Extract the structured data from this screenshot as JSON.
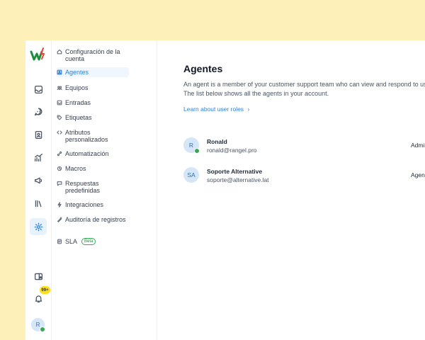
{
  "main": {
    "title": "Agentes",
    "description_line1": "An agent is a member of your customer support team who can view and respond to user messages.",
    "description_line2": "The list below shows all the agents in your account.",
    "learn_link": "Learn about user roles",
    "agents": [
      {
        "initials": "R",
        "name": "Ronald",
        "email": "ronald@rangel.pro",
        "role": "Administrador",
        "online": true
      },
      {
        "initials": "SA",
        "name": "Soporte Alternative",
        "email": "soporte@alternative.lat",
        "role": "Agente",
        "online": false
      }
    ]
  },
  "settings_nav": {
    "items": [
      {
        "label": "Configuración de la cuenta",
        "icon": "home-icon"
      },
      {
        "label": "Agentes",
        "icon": "agents-icon",
        "active": true
      },
      {
        "label": "Equipos",
        "icon": "teams-icon"
      },
      {
        "label": "Entradas",
        "icon": "inboxes-icon"
      },
      {
        "label": "Etiquetas",
        "icon": "tag-icon"
      },
      {
        "label": "Atributos personalizados",
        "icon": "code-icon"
      },
      {
        "label": "Automatización",
        "icon": "automation-icon"
      },
      {
        "label": "Macros",
        "icon": "macros-icon"
      },
      {
        "label": "Respuestas predefinidas",
        "icon": "canned-responses-icon"
      },
      {
        "label": "Integraciones",
        "icon": "integrations-icon"
      },
      {
        "label": "Auditoría de registros",
        "icon": "audit-logs-icon"
      },
      {
        "label": "SLA",
        "icon": "sla-icon",
        "badge": "Beta"
      }
    ]
  },
  "rail": {
    "items": [
      "inbox-icon",
      "conversations-icon",
      "contacts-icon",
      "reports-icon",
      "campaigns-icon",
      "library-icon",
      "settings-icon"
    ],
    "notification_count": "99+",
    "user_initials": "R"
  },
  "colors": {
    "accent": "#2f7fd6",
    "page_background": "#fdf0b8",
    "online": "#34a853",
    "logo_red": "#e8443a",
    "logo_green": "#1e8e3e"
  }
}
